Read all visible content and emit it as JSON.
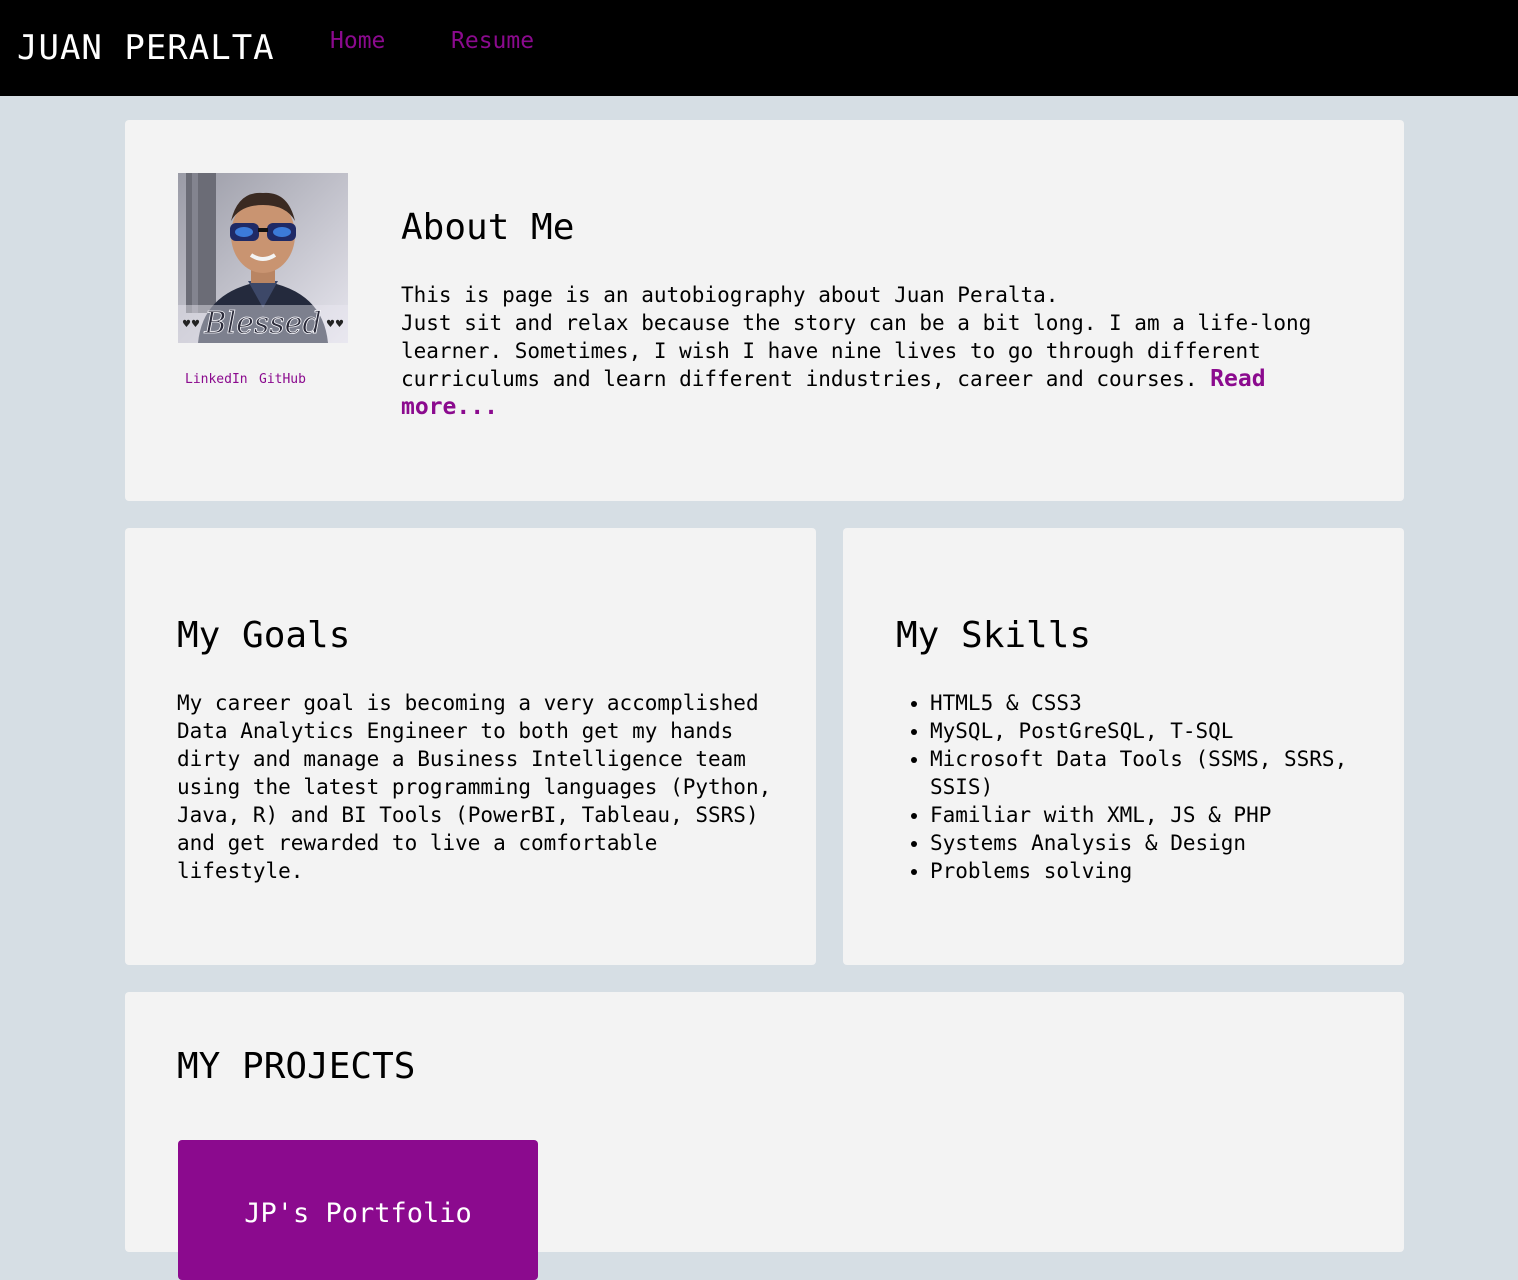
{
  "header": {
    "brand": "JUAN PERALTA",
    "nav": [
      "Home",
      "Resume"
    ],
    "link_color": "#8b0a8e",
    "background": "#000000"
  },
  "about": {
    "title": "About Me",
    "line1": "This is page is an autobiography about Juan Peralta.",
    "body": "Just sit and relax because the story can be a bit long. I am a life-long learner. Sometimes, I wish I have nine lives to go through different curriculums and learn different industries, career and courses.",
    "read_more": "Read more...",
    "avatar_caption": "Blessed",
    "social": [
      "LinkedIn",
      "GitHub"
    ]
  },
  "goals": {
    "title": "My Goals",
    "text": "My career goal is becoming a very accomplished Data Analytics Engineer to both get my hands dirty and manage a Business Intelligence team using the latest programming languages (Python, Java, R) and BI Tools (PowerBI, Tableau, SSRS) and get rewarded to live a comfortable lifestyle."
  },
  "skills": {
    "title": "My Skills",
    "items": [
      "HTML5 & CSS3",
      "MySQL, PostGreSQL, T-SQL",
      "Microsoft Data Tools (SSMS, SSRS, SSIS)",
      "Familiar with XML, JS & PHP",
      "Systems Analysis & Design",
      "Problems solving"
    ]
  },
  "projects": {
    "title": "MY PROJECTS",
    "items": [
      "JP's Portfolio"
    ],
    "card_color": "#8b0a8e"
  }
}
